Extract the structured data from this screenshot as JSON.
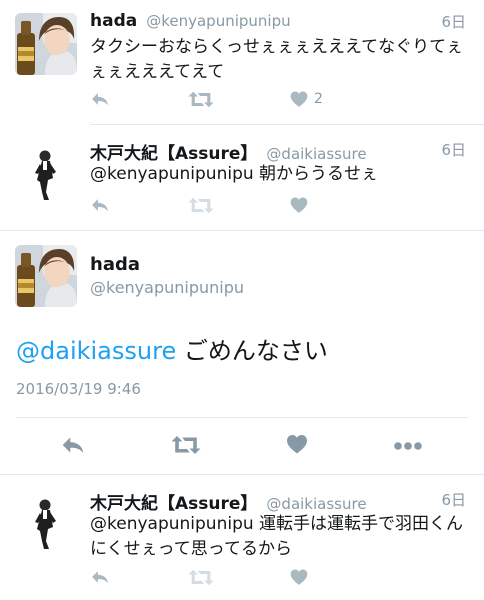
{
  "tweets": [
    {
      "name": "hada",
      "handle": "@kenyapunipunipu",
      "time": "6日",
      "text": "タクシーおならくっせぇぇぇえええてなぐりてぇぇぇえええてえて",
      "likes": "2"
    },
    {
      "name": "木戸大紀【Assure】",
      "handle": "@daikiassure",
      "time": "6日",
      "text": "@kenyapunipunipu 朝からうるせぇ"
    }
  ],
  "focused": {
    "name": "hada",
    "handle": "@kenyapunipunipu",
    "mention": "@daikiassure",
    "text": " ごめんなさい",
    "timestamp": "2016/03/19 9:46"
  },
  "reply": {
    "name": "木戸大紀【Assure】",
    "handle": "@daikiassure",
    "time": "6日",
    "text": "@kenyapunipunipu 運転手は運転手で羽田くんにくせぇって思ってるから"
  },
  "icons": [
    "reply-icon",
    "retweet-icon",
    "like-icon",
    "more-icon"
  ],
  "colors": {
    "icon": "#aab8c2",
    "icon_dark": "#8899a6",
    "mention": "#1da1f2",
    "divider": "#e1e8ed"
  }
}
